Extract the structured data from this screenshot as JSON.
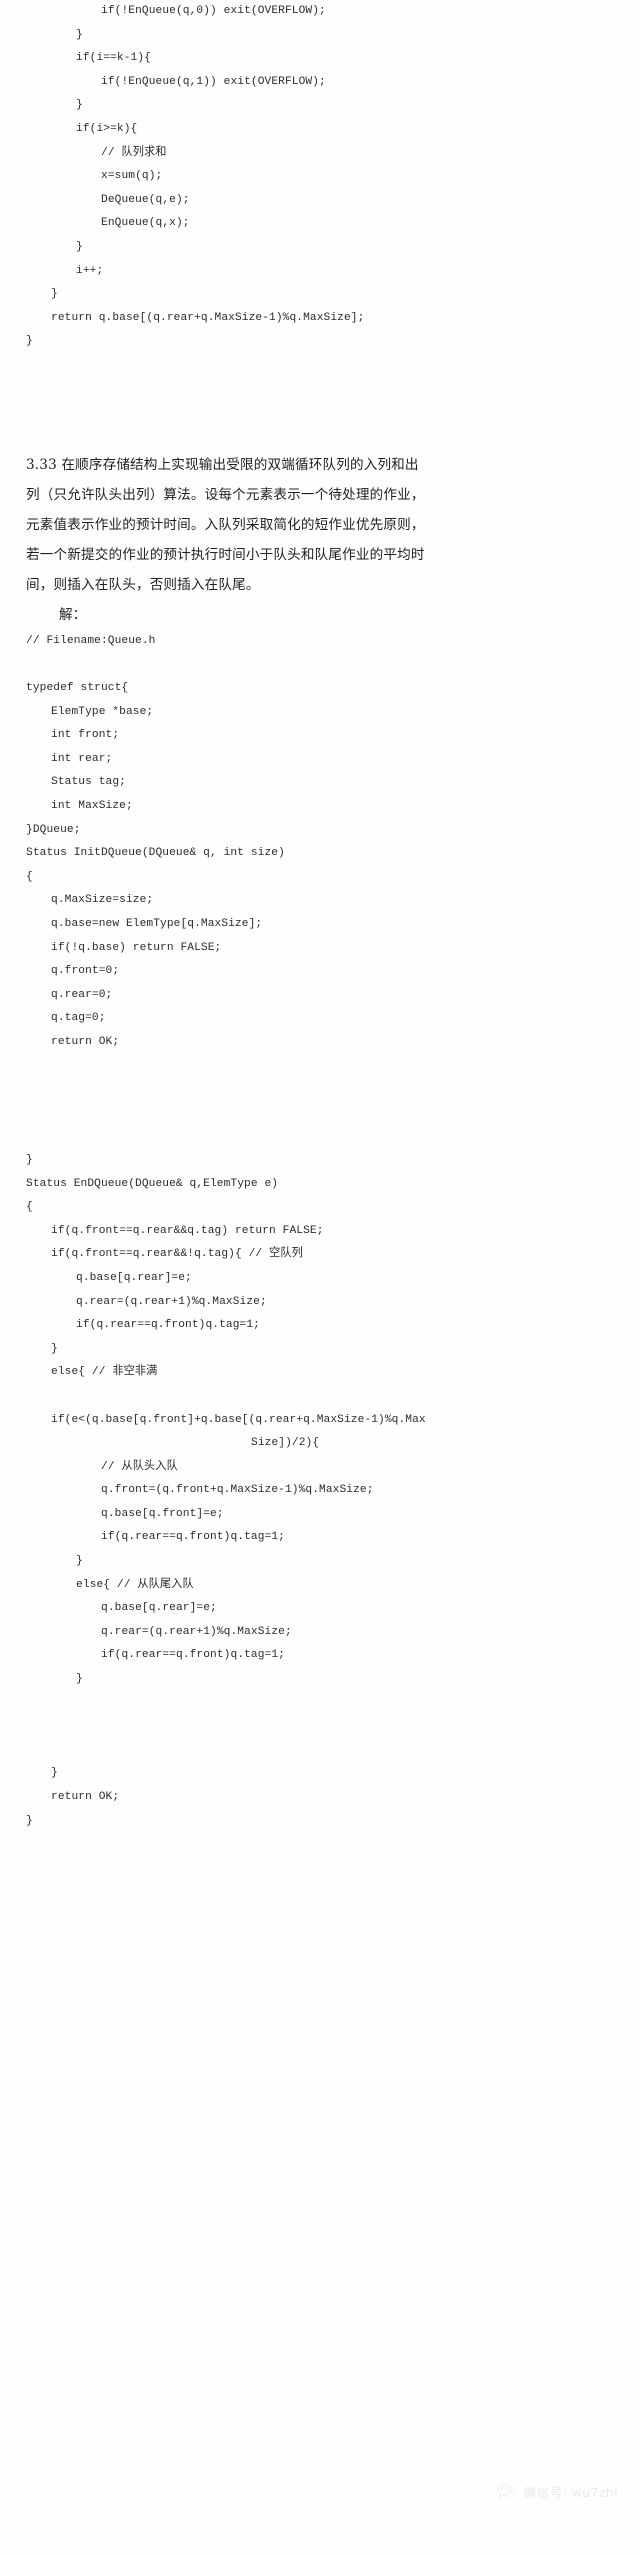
{
  "document": {
    "type": "textbook-solution-page",
    "language": "zh-CN",
    "background_color": "#fefefe",
    "text_color": "#2b2b2b"
  },
  "code_top": {
    "lines": [
      {
        "indent": 3,
        "text": "if(!EnQueue(q,0)) exit(OVERFLOW);"
      },
      {
        "indent": 2,
        "text": "}"
      },
      {
        "indent": 2,
        "text": "if(i==k-1){"
      },
      {
        "indent": 3,
        "text": "if(!EnQueue(q,1)) exit(OVERFLOW);"
      },
      {
        "indent": 2,
        "text": "}"
      },
      {
        "indent": 2,
        "text": "if(i>=k){"
      },
      {
        "indent": 3,
        "text": "// 队列求和"
      },
      {
        "indent": 3,
        "text": "x=sum(q);"
      },
      {
        "indent": 3,
        "text": "DeQueue(q,e);"
      },
      {
        "indent": 3,
        "text": "EnQueue(q,x);"
      },
      {
        "indent": 2,
        "text": "}"
      },
      {
        "indent": 2,
        "text": "i++;"
      },
      {
        "indent": 1,
        "text": "}"
      },
      {
        "indent": 1,
        "text": "return q.base[(q.rear+q.MaxSize-1)%q.MaxSize];"
      },
      {
        "indent": 0,
        "text": "}"
      }
    ]
  },
  "problem": {
    "number": "3.33",
    "lines": [
      "3.33 在顺序存储结构上实现输出受限的双端循环队列的入列和出",
      "列（只允许队头出列）算法。设每个元素表示一个待处理的作业，",
      "元素值表示作业的预计时间。入队列采取简化的短作业优先原则，",
      "若一个新提交的作业的预计执行时间小于队头和队尾作业的平均时",
      "间，则插入在队头，否则插入在队尾。"
    ],
    "answer_label": "解："
  },
  "code_main": {
    "lines": [
      {
        "indent": 0,
        "text": "// Filename:Queue.h"
      },
      {
        "indent": -1,
        "text": ""
      },
      {
        "indent": 0,
        "text": "typedef struct{"
      },
      {
        "indent": 1,
        "text": "ElemType *base;"
      },
      {
        "indent": 1,
        "text": "int front;"
      },
      {
        "indent": 1,
        "text": "int rear;"
      },
      {
        "indent": 1,
        "text": "Status tag;"
      },
      {
        "indent": 1,
        "text": "int MaxSize;"
      },
      {
        "indent": 0,
        "text": "}DQueue;"
      },
      {
        "indent": 0,
        "text": "Status InitDQueue(DQueue& q, int size)"
      },
      {
        "indent": 0,
        "text": "{"
      },
      {
        "indent": 1,
        "text": "q.MaxSize=size;"
      },
      {
        "indent": 1,
        "text": "q.base=new ElemType[q.MaxSize];"
      },
      {
        "indent": 1,
        "text": "if(!q.base) return FALSE;"
      },
      {
        "indent": 1,
        "text": "q.front=0;"
      },
      {
        "indent": 1,
        "text": "q.rear=0;"
      },
      {
        "indent": 1,
        "text": "q.tag=0;"
      },
      {
        "indent": 1,
        "text": "return OK;"
      },
      {
        "indent": -1,
        "text": ""
      },
      {
        "indent": -1,
        "text": ""
      },
      {
        "indent": -1,
        "text": ""
      },
      {
        "indent": -1,
        "text": ""
      },
      {
        "indent": 0,
        "text": "}"
      },
      {
        "indent": 0,
        "text": "Status EnDQueue(DQueue& q,ElemType e)"
      },
      {
        "indent": 0,
        "text": "{"
      },
      {
        "indent": 1,
        "text": "if(q.front==q.rear&&q.tag) return FALSE;"
      },
      {
        "indent": 1,
        "text": "if(q.front==q.rear&&!q.tag){ // 空队列"
      },
      {
        "indent": 2,
        "text": "q.base[q.rear]=e;"
      },
      {
        "indent": 2,
        "text": "q.rear=(q.rear+1)%q.MaxSize;"
      },
      {
        "indent": 2,
        "text": "if(q.rear==q.front)q.tag=1;"
      },
      {
        "indent": 1,
        "text": "}"
      },
      {
        "indent": 1,
        "text": "else{ // 非空非满"
      },
      {
        "indent": -1,
        "text": ""
      },
      {
        "indent": 1,
        "text": "if(e<(q.base[q.front]+q.base[(q.rear+q.MaxSize-1)%q.Max"
      },
      {
        "indent": 9,
        "text": "Size])/2){"
      },
      {
        "indent": 3,
        "text": "// 从队头入队"
      },
      {
        "indent": 3,
        "text": "q.front=(q.front+q.MaxSize-1)%q.MaxSize;"
      },
      {
        "indent": 3,
        "text": "q.base[q.front]=e;"
      },
      {
        "indent": 3,
        "text": "if(q.rear==q.front)q.tag=1;"
      },
      {
        "indent": 2,
        "text": "}"
      },
      {
        "indent": 2,
        "text": "else{ // 从队尾入队"
      },
      {
        "indent": 3,
        "text": "q.base[q.rear]=e;"
      },
      {
        "indent": 3,
        "text": "q.rear=(q.rear+1)%q.MaxSize;"
      },
      {
        "indent": 3,
        "text": "if(q.rear==q.front)q.tag=1;"
      },
      {
        "indent": 2,
        "text": "}"
      },
      {
        "indent": -1,
        "text": ""
      },
      {
        "indent": -1,
        "text": ""
      },
      {
        "indent": -1,
        "text": ""
      },
      {
        "indent": 1,
        "text": "}"
      },
      {
        "indent": 1,
        "text": "return OK;"
      },
      {
        "indent": 0,
        "text": "}"
      }
    ]
  },
  "watermark": {
    "icon": "wechat-icon",
    "text": "微信号: wu7zhi",
    "color": "#b9b9b9"
  }
}
